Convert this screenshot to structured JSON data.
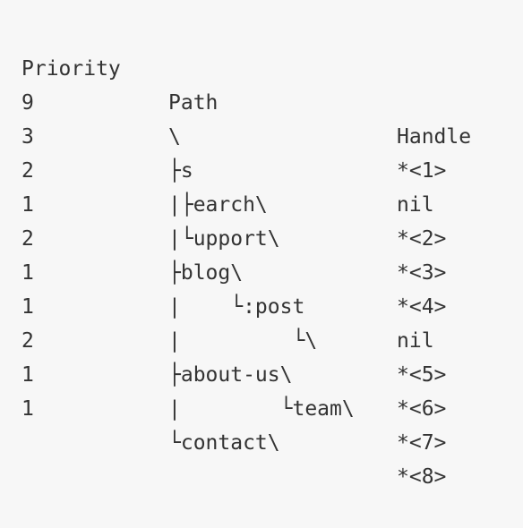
{
  "header": {
    "priority": "Priority",
    "path": "Path",
    "handle": "Handle"
  },
  "rows": [
    {
      "priority": "9",
      "path": "\\",
      "handle": "*<1>"
    },
    {
      "priority": "3",
      "path": "├s",
      "handle": "nil"
    },
    {
      "priority": "2",
      "path": "|├earch\\",
      "handle": "*<2>"
    },
    {
      "priority": "1",
      "path": "|└upport\\",
      "handle": "*<3>"
    },
    {
      "priority": "2",
      "path": "├blog\\",
      "handle": "*<4>"
    },
    {
      "priority": "1",
      "path": "|    └:post",
      "handle": "nil"
    },
    {
      "priority": "1",
      "path": "|         └\\",
      "handle": "*<5>"
    },
    {
      "priority": "2",
      "path": "├about-us\\",
      "handle": "*<6>"
    },
    {
      "priority": "1",
      "path": "|        └team\\",
      "handle": "*<7>"
    },
    {
      "priority": "1",
      "path": "└contact\\",
      "handle": "*<8>"
    }
  ]
}
